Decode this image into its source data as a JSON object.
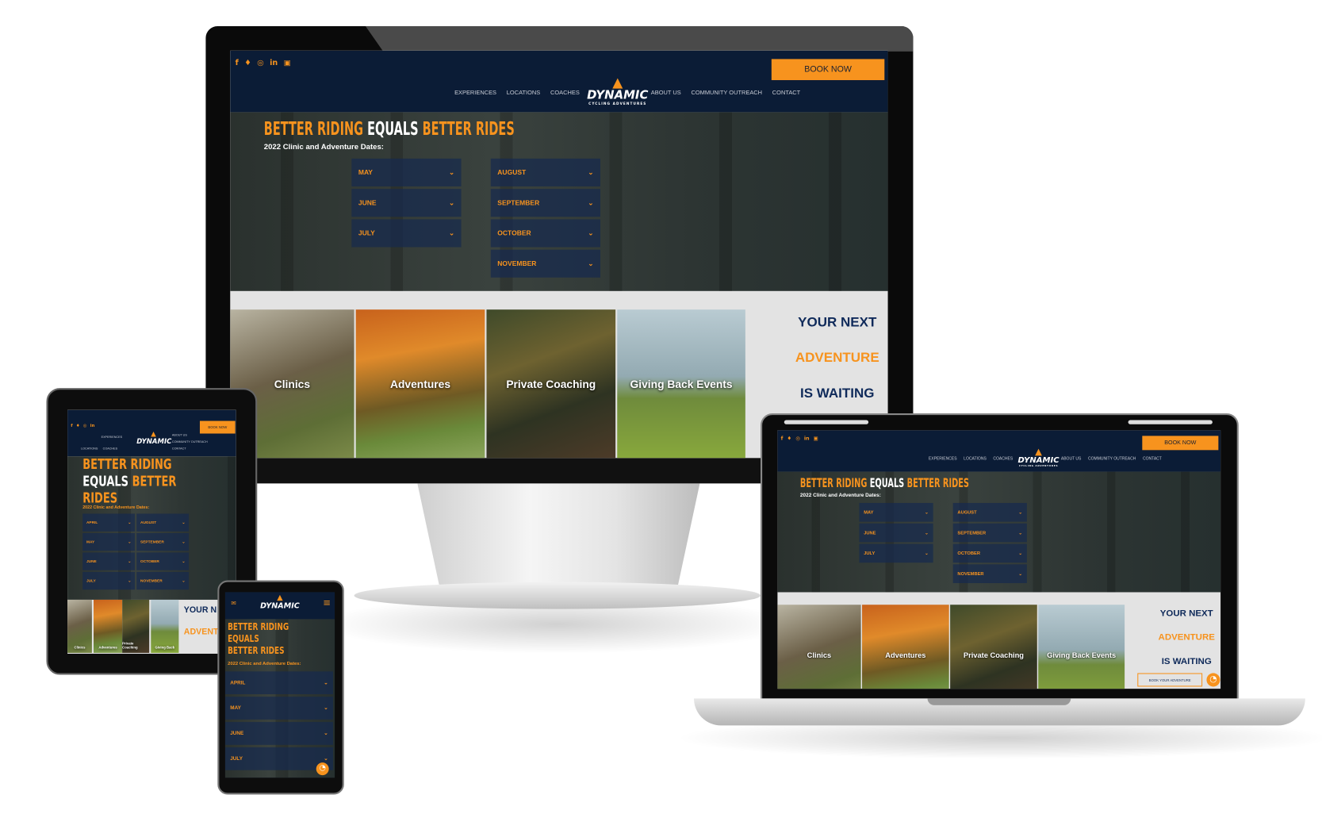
{
  "brand": {
    "logo": "DYNAMIC",
    "logo_sub": "CYCLING ADVENTURES",
    "accent": "#f7931e",
    "navy": "#0b1c36"
  },
  "social": [
    {
      "icon": "facebook-icon",
      "glyph": "f"
    },
    {
      "icon": "twitter-icon",
      "glyph": "🐦"
    },
    {
      "icon": "instagram-icon",
      "glyph": "◎"
    },
    {
      "icon": "linkedin-icon",
      "glyph": "in"
    },
    {
      "icon": "store-icon",
      "glyph": "▣"
    }
  ],
  "header": {
    "book_now": "BOOK NOW"
  },
  "nav": {
    "experiences": "EXPERIENCES",
    "locations": "LOCATIONS",
    "coaches": "COACHES",
    "about": "ABOUT US",
    "outreach": "COMMUNITY OUTREACH",
    "contact": "CONTACT",
    "caret": "⌄"
  },
  "hero": {
    "t1": "BETTER RIDING",
    "t2": "EQUALS",
    "t3": "BETTER RIDES",
    "t3a": "BETTER",
    "t3b": "RIDES",
    "subtitle": "2022 Clinic and Adventure Dates:"
  },
  "months_desktop": [
    "MAY",
    "JUNE",
    "JULY",
    "AUGUST",
    "SEPTEMBER",
    "OCTOBER",
    "NOVEMBER"
  ],
  "months_tablet": [
    "APRIL",
    "MAY",
    "JUNE",
    "JULY",
    "AUGUST",
    "SEPTEMBER",
    "OCTOBER",
    "NOVEMBER"
  ],
  "months_phone": [
    "APRIL",
    "MAY",
    "JUNE",
    "JULY"
  ],
  "chevron": "⌄",
  "cards": [
    "Clinics",
    "Adventures",
    "Private Coaching",
    "Giving Back Events"
  ],
  "tablet_cards": [
    "Clinics",
    "Adventures",
    "Private Coaching",
    "Giving Back"
  ],
  "cta": {
    "line1": "YOUR NEXT",
    "line2": "ADVENTURE",
    "line3": "IS WAITING",
    "button": "BOOK YOUR ADVENTURE",
    "tablet_line1": "YOUR N",
    "tablet_line2": "ADVENT"
  },
  "icons": {
    "messenger": "◔",
    "menu": "≡",
    "mail": "✉"
  }
}
